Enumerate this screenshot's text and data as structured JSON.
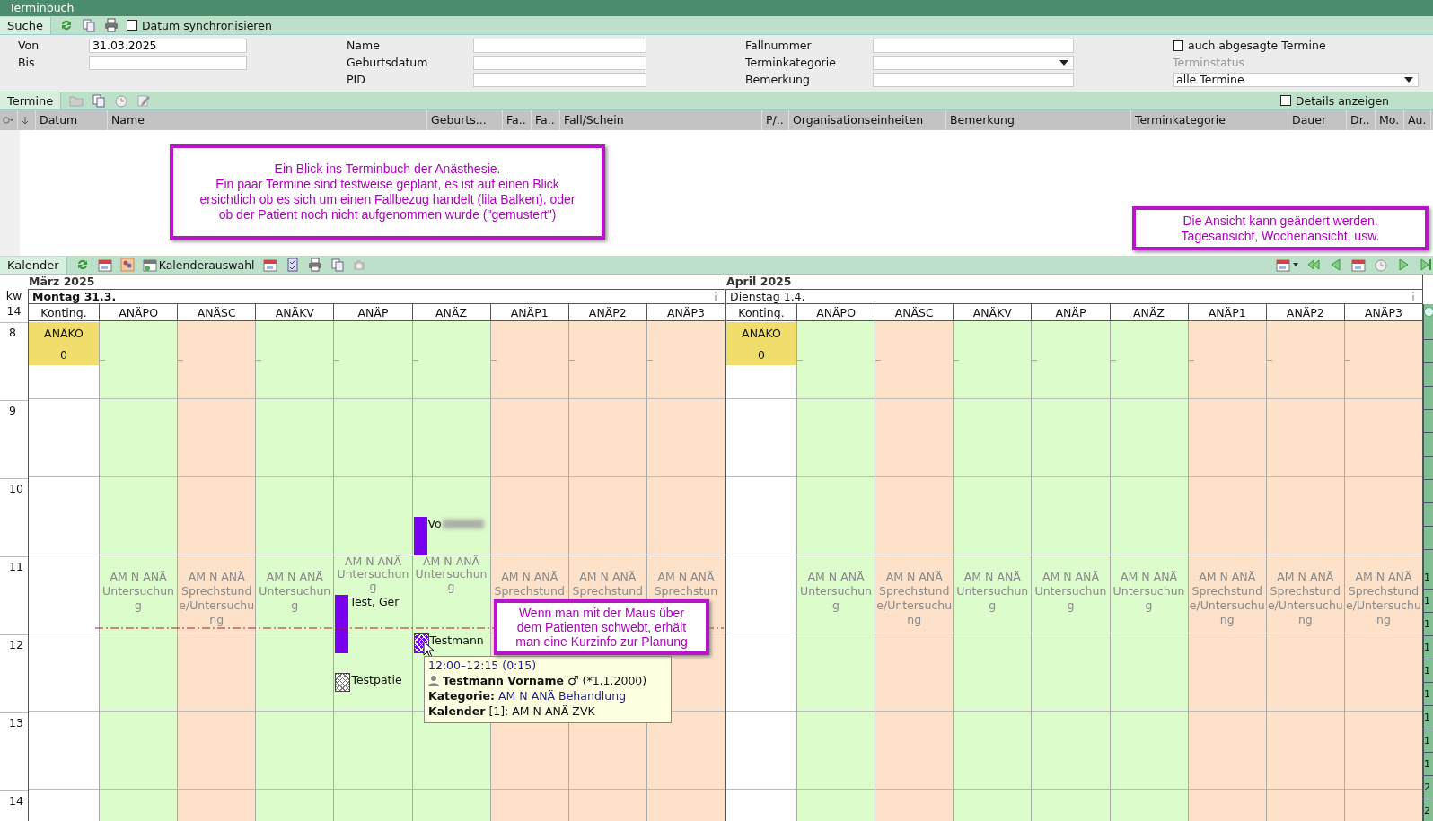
{
  "window": {
    "title": "Terminbuch"
  },
  "search_toolbar": {
    "tab": {
      "label": "Suche",
      "selected": true
    },
    "sync_checkbox": {
      "label": "Datum synchronisieren",
      "checked": false
    }
  },
  "search_form": {
    "columns": [
      [
        {
          "label": "Von",
          "kind": "text",
          "value": "31.03.2025"
        },
        {
          "label": "Bis",
          "kind": "text"
        }
      ],
      [
        {
          "label": "Name",
          "kind": "text"
        },
        {
          "label": "Geburtsdatum",
          "kind": "text"
        },
        {
          "label": "PID",
          "kind": "text"
        }
      ],
      [
        {
          "label": "Fallnummer",
          "kind": "text"
        },
        {
          "label": "Terminkategorie",
          "kind": "dropdown"
        },
        {
          "label": "Bemerkung",
          "kind": "text"
        }
      ]
    ],
    "cancelled_checkbox": {
      "label": "auch abgesagte Termine",
      "checked": false
    },
    "status": {
      "label": "Terminstatus",
      "value": "alle Termine",
      "disabled": true
    }
  },
  "termine_toolbar": {
    "tab": {
      "label": "Termine",
      "selected": true
    },
    "details_checkbox": {
      "label": "Details anzeigen",
      "checked": false
    }
  },
  "table": {
    "columns": [
      "Datum",
      "Name",
      "Geburts...",
      "Fa..",
      "Fa..",
      "Fall/Schein",
      "P/..",
      "Organisationseinheiten",
      "Bemerkung",
      "Terminkategorie",
      "Dauer",
      "Dr..",
      "Mo.",
      "Au."
    ]
  },
  "annotations": [
    {
      "text": "Ein Blick ins Terminbuch der Anästhesie.\nEin paar Termine sind testweise geplant, es ist auf einen Blick\nersichtlich ob es sich um einen Fallbezug handelt (lila Balken), oder\nob der Patient noch nicht aufgenommen wurde (\"gemustert\")"
    },
    {
      "text": "Die Ansicht kann geändert werden.\nTagesansicht, Wochenansicht, usw."
    },
    {
      "text": "Wenn man mit der Maus über\ndem Patienten schwebt, erhält\nman eine Kurzinfo zur Planung"
    }
  ],
  "calendar": {
    "tab": {
      "label": "Kalender",
      "selected": true
    },
    "selection_button": "Kalenderauswahl",
    "kw_label": "kw",
    "kw": "14",
    "hours": [
      "8",
      "9",
      "10",
      "11",
      "12",
      "13",
      "14"
    ],
    "days": [
      {
        "month": "März 2025",
        "title": "Montag 31.3.",
        "selected": true,
        "current_time_line": true,
        "columns": [
          {
            "name": "Konting.",
            "kind": "quota",
            "quota": {
              "label": "ANÄKO",
              "count": "0"
            }
          },
          {
            "name": "ANÄPO",
            "kind": "resource",
            "color": "#ddfccb",
            "block": "AM N ANÄ Untersuchung"
          },
          {
            "name": "ANÄSC",
            "kind": "resource",
            "color": "#fde2c9",
            "block": "AM N ANÄ Sprechstunde/Untersuchung"
          },
          {
            "name": "ANÄKV",
            "kind": "resource",
            "color": "#ddfccb",
            "block": "AM N ANÄ Untersuchung"
          },
          {
            "name": "ANÄP",
            "kind": "resource",
            "color": "#ddfccb",
            "block": "AM N ANÄ Untersuchung",
            "appointments": [
              {
                "name": "Test, Ger",
                "kind": "case",
                "hovered": false,
                "blurred": false
              },
              {
                "name": "Testpatie",
                "kind": "pending",
                "hovered": false,
                "blurred": false
              }
            ]
          },
          {
            "name": "ANÄZ",
            "kind": "resource",
            "color": "#ddfccb",
            "block": "AM N ANÄ Untersuchung",
            "appointments": [
              {
                "name": "Vo",
                "kind": "case",
                "hovered": false,
                "blurred": true
              },
              {
                "name": "Testmann",
                "kind": "pending",
                "hovered": true,
                "blurred": false
              }
            ]
          },
          {
            "name": "ANÄP1",
            "kind": "resource",
            "color": "#fde2c9",
            "block": "AM N ANÄ Sprechstund"
          },
          {
            "name": "ANÄP2",
            "kind": "resource",
            "color": "#fde2c9",
            "block": "AM N ANÄ Sprechstund"
          },
          {
            "name": "ANÄP3",
            "kind": "resource",
            "color": "#fde2c9",
            "block": "AM N ANÄ Sprechstun"
          }
        ]
      },
      {
        "month": "April 2025",
        "title": "Dienstag 1.4.",
        "selected": false,
        "current_time_line": false,
        "columns": [
          {
            "name": "Konting.",
            "kind": "quota",
            "quota": {
              "label": "ANÄKO",
              "count": "0"
            }
          },
          {
            "name": "ANÄPO",
            "kind": "resource",
            "color": "#ddfccb",
            "block": "AM N ANÄ Untersuchung"
          },
          {
            "name": "ANÄSC",
            "kind": "resource",
            "color": "#fde2c9",
            "block": "AM N ANÄ Sprechstunde/Untersuchung"
          },
          {
            "name": "ANÄKV",
            "kind": "resource",
            "color": "#ddfccb",
            "block": "AM N ANÄ Untersuchung"
          },
          {
            "name": "ANÄP",
            "kind": "resource",
            "color": "#ddfccb",
            "block": "AM N ANÄ Untersuchung"
          },
          {
            "name": "ANÄZ",
            "kind": "resource",
            "color": "#ddfccb",
            "block": "AM N ANÄ Untersuchung"
          },
          {
            "name": "ANÄP1",
            "kind": "resource",
            "color": "#fde2c9",
            "block": "AM N ANÄ Sprechstunde/Untersuchung"
          },
          {
            "name": "ANÄP2",
            "kind": "resource",
            "color": "#fde2c9",
            "block": "AM N ANÄ Sprechstunde/Untersuchung"
          },
          {
            "name": "ANÄP3",
            "kind": "resource",
            "color": "#fde2c9",
            "block": "AM N ANÄ Sprechstunde/Untersuchung"
          }
        ]
      }
    ],
    "tooltip": {
      "time": "12:00–12:15 (0:15)",
      "patient": "Testmann Vorname",
      "gender": "♂",
      "birth": "(*1.1.2000)",
      "category_label": "Kategorie:",
      "category": "AM N ANÄ Behandlung",
      "calendar": "**Kalender** [1]: AM N ANÄ ZVK"
    },
    "side_strip": [
      "1",
      "1",
      "1",
      "1",
      "1",
      "1",
      "1",
      "1",
      "1",
      "2",
      "2"
    ]
  }
}
